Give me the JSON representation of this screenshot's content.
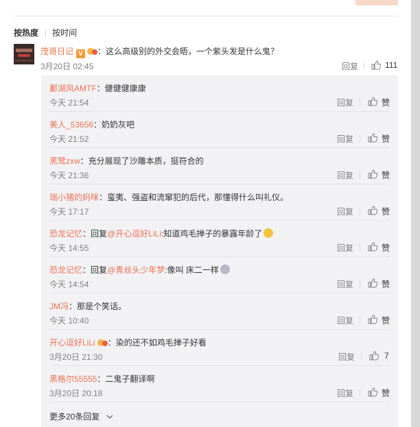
{
  "sort_tabs": {
    "hot": "按热度",
    "time": "按时间"
  },
  "main_comment": {
    "user": "茂哥日记",
    "colon": "：",
    "text": "这么高级别的外交会晤，一个紫头发是什么鬼？",
    "time": "3月20日 02:45",
    "reply_label": "回复",
    "likes": "111"
  },
  "replies": [
    {
      "user": "鄱湖风AMTF",
      "text": "：健健健康康",
      "time": "今天 21:54",
      "reply_label": "回复",
      "likes": "赞"
    },
    {
      "user": "美人_53656",
      "text": "：奶奶灰吧",
      "time": "今天 21:52",
      "reply_label": "回复",
      "likes": "赞"
    },
    {
      "user": "黑鹭zxw",
      "text": "：充分展现了沙雕本质，挺符合的",
      "time": "今天 21:36",
      "reply_label": "回复",
      "likes": "赞"
    },
    {
      "user": "瑞小猪的妈咪",
      "text": "：蛮夷、强盗和流窜犯的后代，那懂得什么叫礼仪。",
      "time": "今天 17:17",
      "reply_label": "回复",
      "likes": "赞"
    },
    {
      "user": "恐龙记忆",
      "text": "：回复",
      "mention": "@开心逗好LiLi",
      "text2": ":知道鸡毛掸子的暴露年龄了",
      "time": "今天 14:55",
      "reply_label": "回复",
      "likes": "赞"
    },
    {
      "user": "恐龙记忆",
      "text": "：回复",
      "mention": "@青丝头少年梦",
      "text2": ":像叫 床二一样",
      "time": "今天 14:54",
      "reply_label": "回复",
      "likes": "赞"
    },
    {
      "user": "JM冯",
      "text": "：那是个笑话。",
      "time": "今天 10:40",
      "reply_label": "回复",
      "likes": "赞"
    },
    {
      "user": "开心逗好LiLi",
      "text": "：染的还不如鸡毛掸子好看",
      "time": "3月20日 21:30",
      "reply_label": "回复",
      "likes": "7"
    },
    {
      "user": "黑格尔55555",
      "text": "：二鬼子翻译啊",
      "time": "3月20日 20:18",
      "reply_label": "回复",
      "likes": "赞"
    }
  ],
  "more_replies": "更多20条回复",
  "colors": {
    "username": "#eb7350",
    "meta": "#808080",
    "sub_bg": "#f2f2f5"
  }
}
